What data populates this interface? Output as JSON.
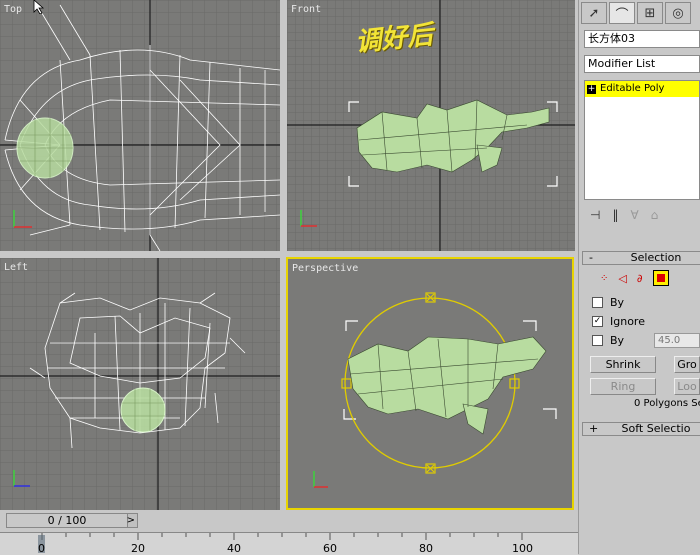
{
  "viewports": {
    "top": "Top",
    "front": "Front",
    "left": "Left",
    "perspective": "Perspective"
  },
  "annotation": "调好后",
  "panel": {
    "tabs": [
      "create-arrow-icon",
      "modify-icon",
      "hierarchy-icon",
      "motion-icon"
    ],
    "object_name": "长方体03",
    "modifier_list": "Modifier List",
    "stack_item": "Editable Poly",
    "selection_rollout": "Selection",
    "by_vertex": "By",
    "ignore_backfacing": "Ignore",
    "by_angle": "By",
    "angle_value": "45.0",
    "shrink": "Shrink",
    "grow": "Gro",
    "ring": "Ring",
    "loop": "Loo",
    "selection_status": "0 Polygons Se",
    "soft_selection_rollout": "Soft Selectio"
  },
  "timeline": {
    "frame_display": "0 / 100",
    "ticks": [
      "0",
      "20",
      "40",
      "60",
      "80",
      "100"
    ]
  },
  "colors": {
    "viewport_bg": "#7a7a78",
    "active_border": "#e8d400",
    "mesh_green": "#b8dca0",
    "stack_highlight": "#ffff00"
  }
}
